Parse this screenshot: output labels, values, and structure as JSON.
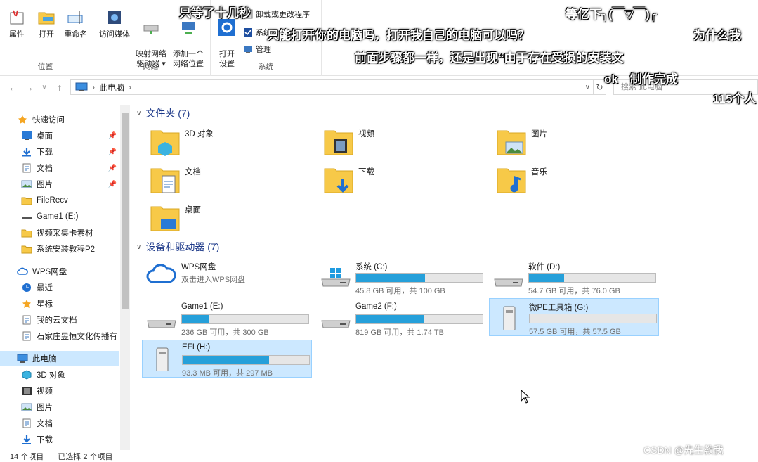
{
  "ribbon": {
    "groups": [
      {
        "label": "位置"
      },
      {
        "label": "网络"
      },
      {
        "label": "系统"
      }
    ],
    "buttons": [
      {
        "label": "属性"
      },
      {
        "label": "打开"
      },
      {
        "label": "重命名"
      },
      {
        "label": "访问媒体"
      },
      {
        "label": "映射网络\n驱动器 ▾"
      },
      {
        "label": "添加一个\n网络位置"
      },
      {
        "label": "打开\n设置"
      }
    ],
    "small_buttons": [
      "卸载或更改程序",
      "系统属性",
      "管理"
    ]
  },
  "address": {
    "path": "此电脑",
    "search_placeholder": "搜索\"此电脑\""
  },
  "sidebar": {
    "items": [
      {
        "label": "快速访问",
        "icon": "star-icon",
        "pinned": false
      },
      {
        "label": "桌面",
        "icon": "desktop-icon",
        "pinned": true
      },
      {
        "label": "下载",
        "icon": "download-icon",
        "pinned": true
      },
      {
        "label": "文档",
        "icon": "document-icon",
        "pinned": true
      },
      {
        "label": "图片",
        "icon": "picture-icon",
        "pinned": true
      },
      {
        "label": "FileRecv",
        "icon": "folder-icon",
        "pinned": false
      },
      {
        "label": "Game1 (E:)",
        "icon": "drive-icon",
        "pinned": false
      },
      {
        "label": "视频采集卡素材",
        "icon": "folder-icon",
        "pinned": false
      },
      {
        "label": "系统安装教程P2",
        "icon": "folder-icon",
        "pinned": false
      },
      {
        "label": "WPS网盘",
        "icon": "cloud-icon",
        "pinned": false
      },
      {
        "label": "最近",
        "icon": "clock-icon",
        "pinned": false
      },
      {
        "label": "星标",
        "icon": "star-icon",
        "pinned": false
      },
      {
        "label": "我的云文档",
        "icon": "document-icon",
        "pinned": false
      },
      {
        "label": "石家庄昱恒文化传播有",
        "icon": "document-icon",
        "pinned": false
      },
      {
        "label": "此电脑",
        "icon": "computer-icon",
        "pinned": false
      },
      {
        "label": "3D 对象",
        "icon": "cube-icon",
        "pinned": false
      },
      {
        "label": "视频",
        "icon": "video-icon",
        "pinned": false
      },
      {
        "label": "图片",
        "icon": "picture-icon",
        "pinned": false
      },
      {
        "label": "文档",
        "icon": "document-icon",
        "pinned": false
      },
      {
        "label": "下载",
        "icon": "download-icon",
        "pinned": false
      }
    ]
  },
  "folders_section": {
    "title": "文件夹 (7)",
    "items": [
      "3D 对象",
      "视频",
      "图片",
      "文档",
      "下载",
      "音乐",
      "桌面"
    ]
  },
  "drives_section": {
    "title": "设备和驱动器 (7)",
    "items": [
      {
        "name": "WPS网盘",
        "subtitle": "双击进入WPS网盘",
        "used_fraction": null
      },
      {
        "name": "系统 (C:)",
        "subtitle": "45.8 GB 可用，共 100 GB",
        "used_fraction": 0.542
      },
      {
        "name": "软件 (D:)",
        "subtitle": "54.7 GB 可用，共 76.0 GB",
        "used_fraction": 0.28
      },
      {
        "name": "Game1 (E:)",
        "subtitle": "236 GB 可用，共 300 GB",
        "used_fraction": 0.213
      },
      {
        "name": "Game2 (F:)",
        "subtitle": "819 GB 可用，共 1.74 TB",
        "used_fraction": 0.54
      },
      {
        "name": "微PE工具箱 (G:)",
        "subtitle": "57.5 GB 可用，共 57.5 GB",
        "used_fraction": 0.0
      },
      {
        "name": "EFI (H:)",
        "subtitle": "93.3 MB 可用，共 297 MB",
        "used_fraction": 0.686
      }
    ]
  },
  "status": {
    "count": "14 个项目",
    "selected": "已选择 2 个项目"
  },
  "subtitles": [
    "只等了十几秒",
    "只能打开你的电脑吗，打开我自己的电脑可以吗？",
    "前面步骤都一样，还是出现“由于存在受损的安装文",
    "等亿下╮(￣▽￣)╭",
    "为什么我",
    "ok　制作完成",
    "115个人"
  ],
  "watermark": "CSDN @先生教我",
  "colors": {
    "accent": "#26a0da",
    "selection": "#cce8ff",
    "heading": "#1e3a8a"
  }
}
